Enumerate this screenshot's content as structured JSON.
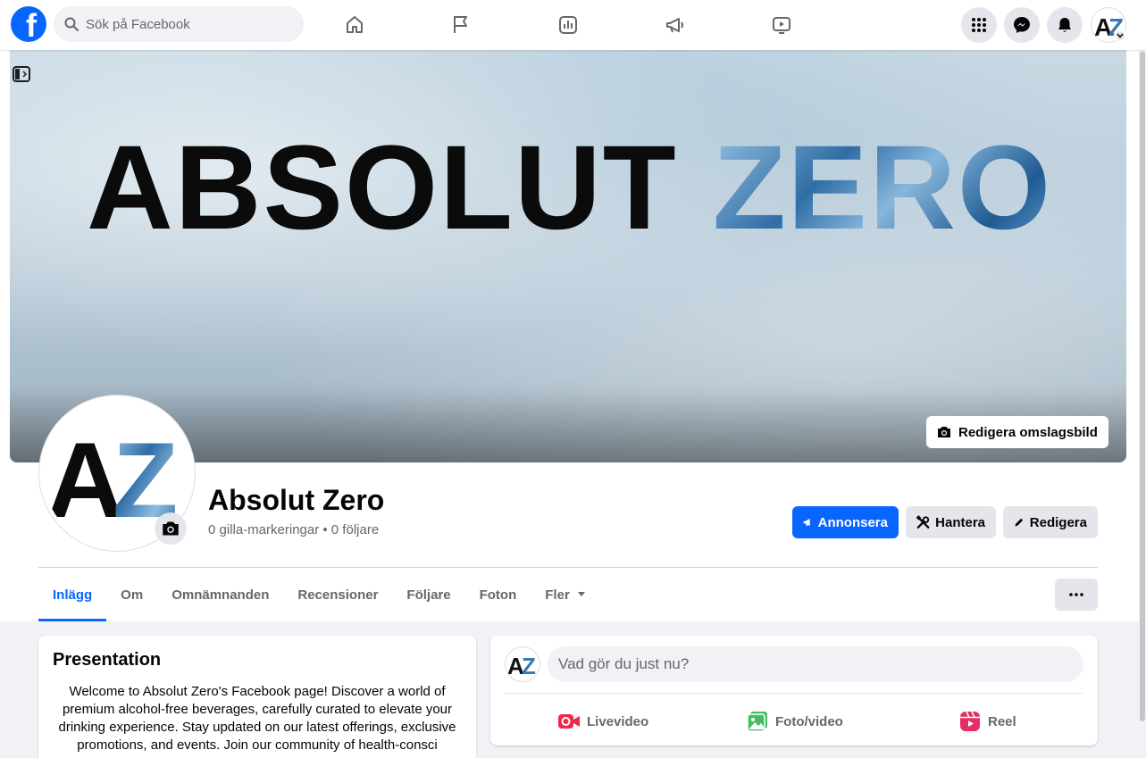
{
  "topbar": {
    "logo": "facebook-logo",
    "logo_letter": "f",
    "search_placeholder": "Sök på Facebook",
    "nav_icons": [
      "home-icon",
      "flag-icon",
      "insights-icon",
      "megaphone-icon",
      "watch-icon"
    ],
    "right_icons": [
      "menu-grid-icon",
      "messenger-icon",
      "bell-icon"
    ]
  },
  "brand": {
    "initials_a": "A",
    "initials_z": "Z"
  },
  "cover": {
    "title_word1": "ABSOLUT",
    "title_word2": "ZERO",
    "edit_label": "Redigera omslagsbild"
  },
  "page": {
    "name": "Absolut Zero",
    "stats": "0 gilla-markeringar • 0 följare"
  },
  "actions": {
    "advertise": "Annonsera",
    "manage": "Hantera",
    "edit": "Redigera"
  },
  "tabs": [
    {
      "label": "Inlägg",
      "active": true
    },
    {
      "label": "Om"
    },
    {
      "label": "Omnämnanden"
    },
    {
      "label": "Recensioner"
    },
    {
      "label": "Följare"
    },
    {
      "label": "Foton"
    },
    {
      "label": "Fler"
    }
  ],
  "intro": {
    "title": "Presentation",
    "text": "Welcome to Absolut Zero's Facebook page! Discover a world of premium alcohol-free beverages, carefully curated to elevate your drinking experience. Stay updated on our latest offerings, exclusive promotions, and events. Join our community of health-consci"
  },
  "composer": {
    "placeholder": "Vad gör du just nu?",
    "live": "Livevideo",
    "photo": "Foto/video",
    "reel": "Reel"
  },
  "colors": {
    "accent": "#0866ff",
    "live_red": "#f02849",
    "photo_green": "#45bd62",
    "reel_pink": "#e42d62"
  }
}
